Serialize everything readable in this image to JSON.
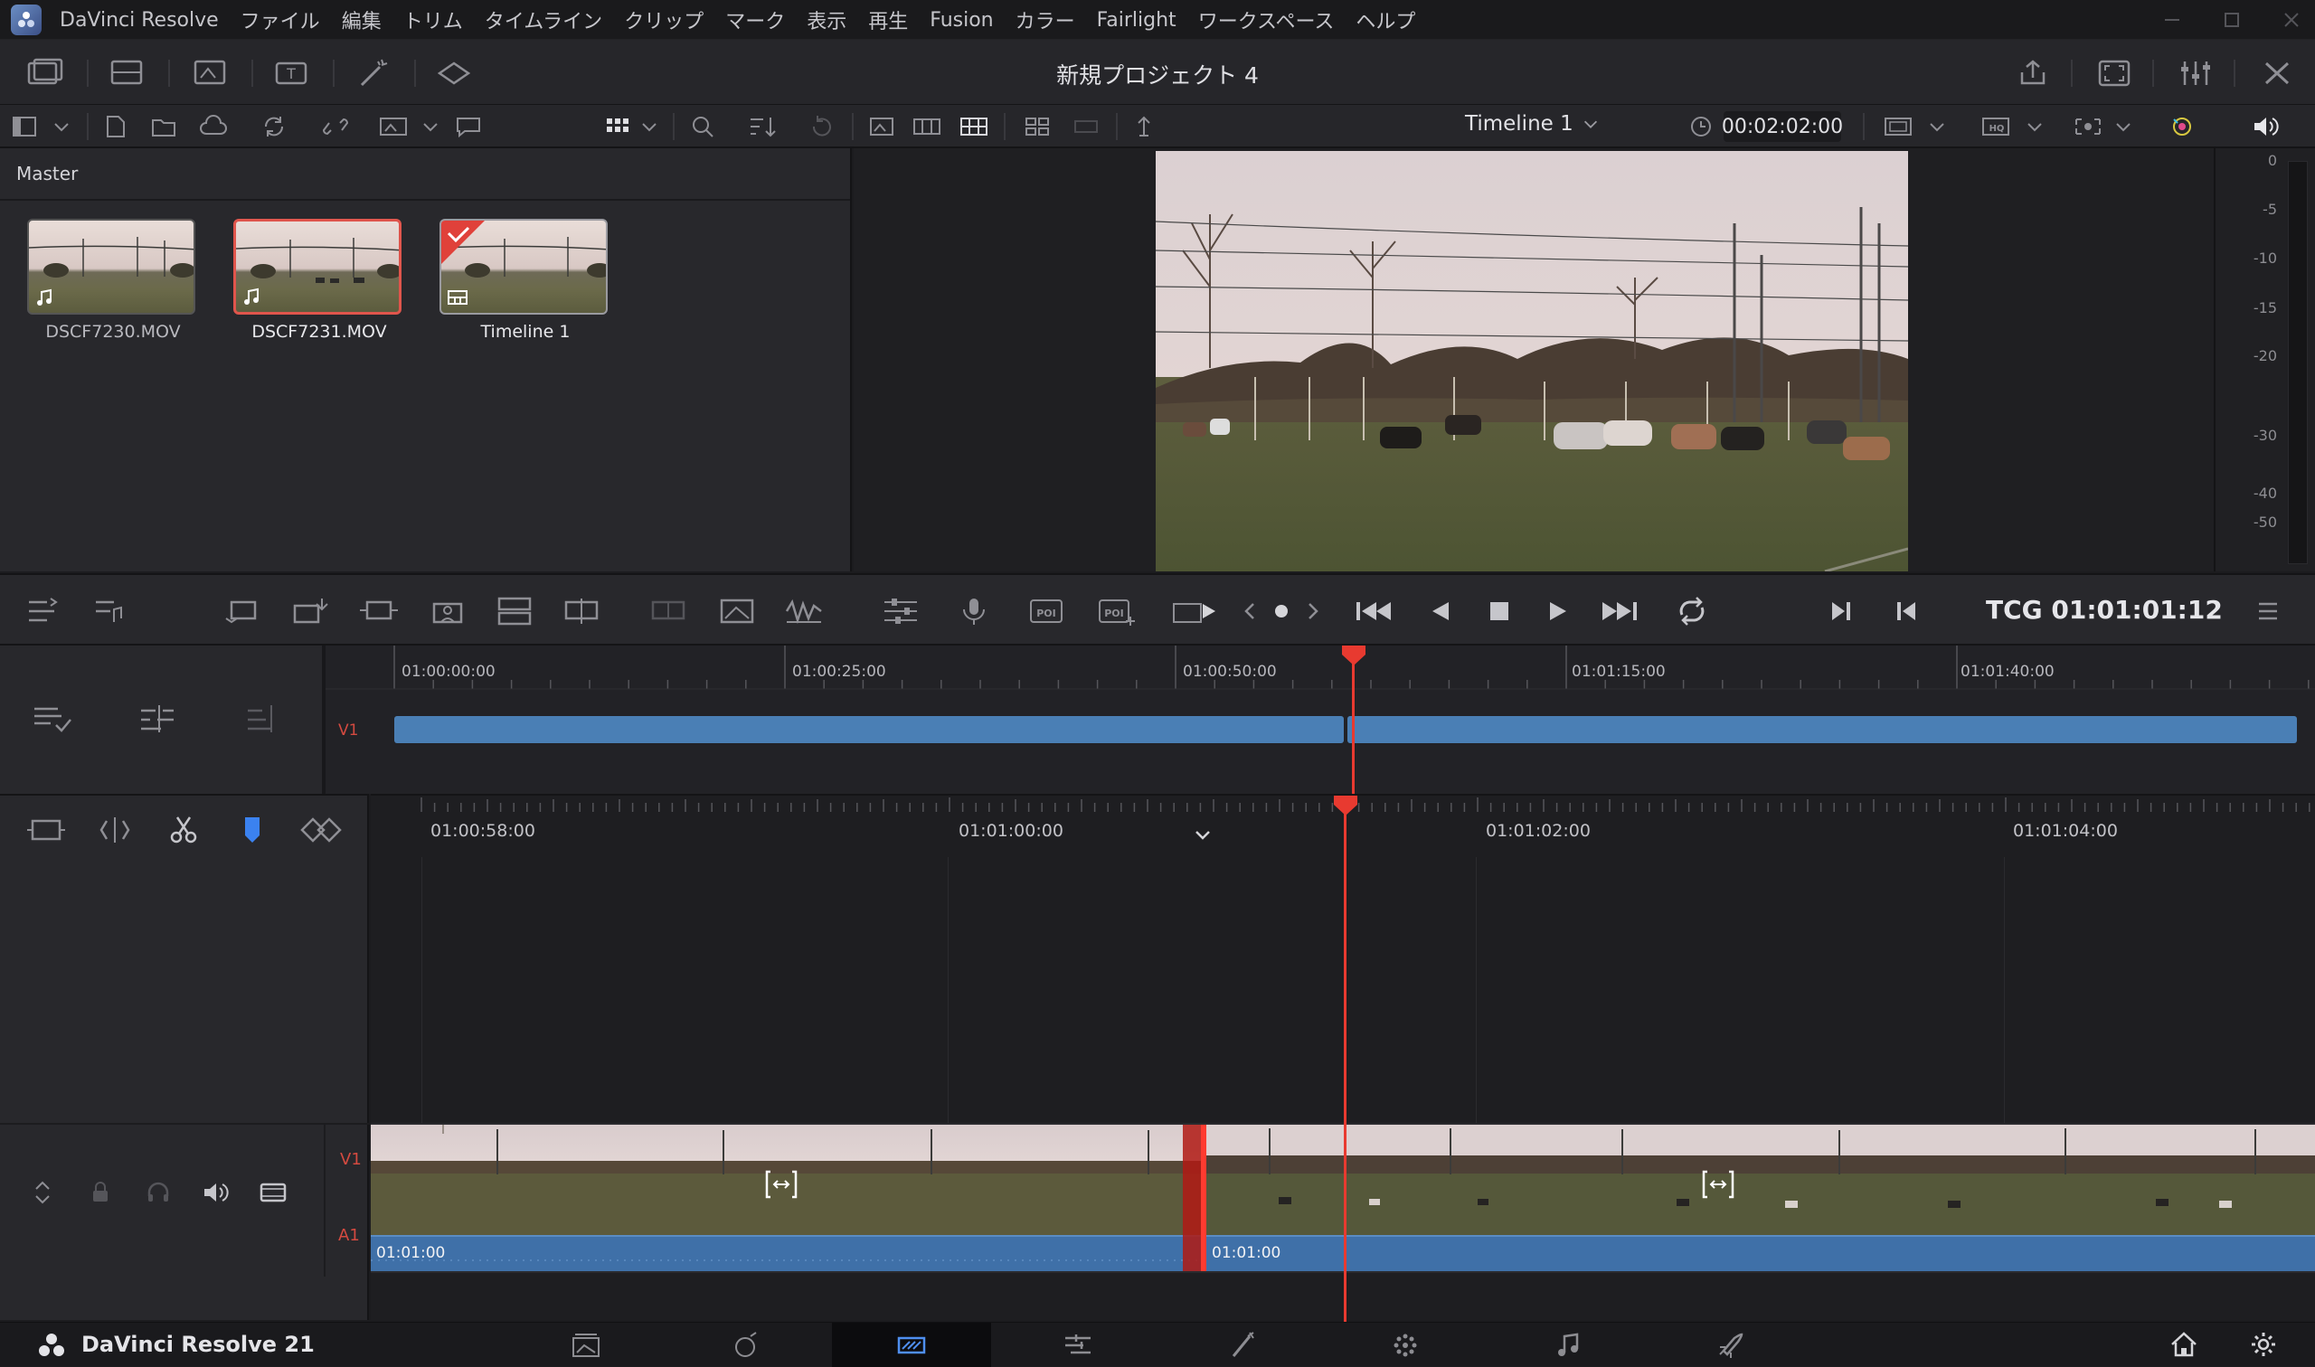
{
  "menubar": {
    "app_name": "DaVinci Resolve",
    "items": [
      "ファイル",
      "編集",
      "トリム",
      "タイムライン",
      "クリップ",
      "マーク",
      "表示",
      "再生",
      "Fusion",
      "カラー",
      "Fairlight",
      "ワークスペース",
      "ヘルプ"
    ]
  },
  "toolbar": {
    "project_title": "新規プロジェクト 4"
  },
  "media_pool": {
    "bin_name": "Master",
    "clips": [
      {
        "name": "DSCF7230.MOV",
        "selected": false,
        "icon": "audio-clip-icon"
      },
      {
        "name": "DSCF7231.MOV",
        "selected": true,
        "icon": "audio-clip-icon"
      },
      {
        "name": "Timeline 1",
        "selected": false,
        "icon": "timeline-clip-icon"
      }
    ]
  },
  "viewer": {
    "timeline_name": "Timeline 1",
    "duration": "00:02:02:00"
  },
  "audio_meter": {
    "scale": [
      "0",
      "-5",
      "-10",
      "-15",
      "-20",
      "-30",
      "-40",
      "-50"
    ]
  },
  "transport": {
    "timecode_label": "TCG 01:01:01:12"
  },
  "upper_timeline": {
    "track_label": "V1",
    "ruler": [
      "01:00:00:00",
      "01:00:25:00",
      "01:00:50:00",
      "01:01:15:00",
      "01:01:40:00"
    ]
  },
  "lower_timeline": {
    "ruler": [
      "01:00:58:00",
      "01:01:00:00",
      "01:01:02:00",
      "01:01:04:00"
    ],
    "video_track_label": "V1",
    "audio_track_label": "A1",
    "clip_a_timecode": "01:01:00",
    "clip_b_timecode": "01:01:00"
  },
  "bottom": {
    "brand": "DaVinci Resolve 21",
    "pages": [
      "media",
      "cut",
      "edit",
      "fusion",
      "color",
      "fairlight",
      "deliver"
    ],
    "active_page": "edit"
  },
  "colors": {
    "accent_blue": "#4f8ff0",
    "playhead_red": "#e83a30",
    "clip_blue": "#4a7fb5"
  }
}
